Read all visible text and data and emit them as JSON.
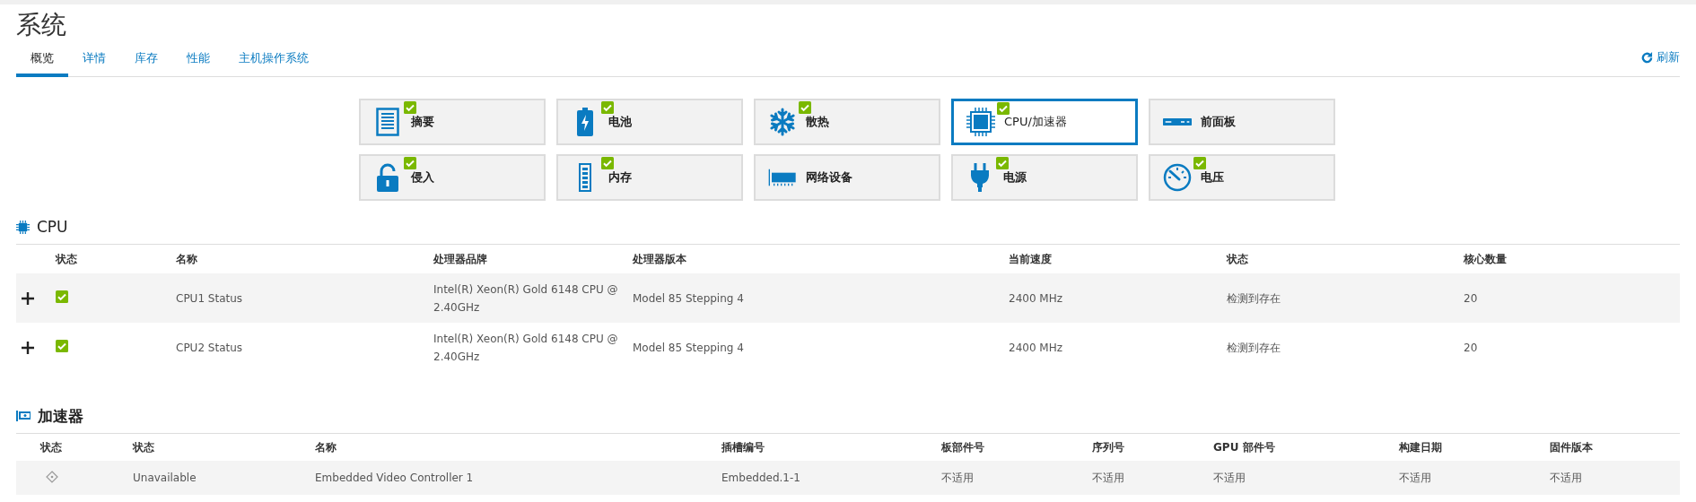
{
  "title": "系统",
  "tabs": [
    {
      "label": "概览",
      "selected": true
    },
    {
      "label": "详情",
      "selected": false
    },
    {
      "label": "库存",
      "selected": false
    },
    {
      "label": "性能",
      "selected": false
    },
    {
      "label": "主机操作系统",
      "selected": false
    }
  ],
  "refresh": "刷新",
  "tiles": [
    {
      "label": "摘要",
      "ok": true,
      "selected": false
    },
    {
      "label": "电池",
      "ok": true,
      "selected": false
    },
    {
      "label": "散热",
      "ok": true,
      "selected": false
    },
    {
      "label": "CPU/加速器",
      "ok": true,
      "selected": true
    },
    {
      "label": "前面板",
      "ok": false,
      "selected": false
    },
    {
      "label": "侵入",
      "ok": true,
      "selected": false
    },
    {
      "label": "内存",
      "ok": true,
      "selected": false
    },
    {
      "label": "网络设备",
      "ok": false,
      "selected": false
    },
    {
      "label": "电源",
      "ok": true,
      "selected": false
    },
    {
      "label": "电压",
      "ok": true,
      "selected": false
    }
  ],
  "cpu": {
    "title": "CPU",
    "status_column": "状态",
    "columns": [
      "名称",
      "处理器品牌",
      "处理器版本",
      "当前速度",
      "状态",
      "核心数量"
    ],
    "rows": [
      {
        "expanded": false,
        "ok": true,
        "cells": [
          "CPU1 Status",
          "Intel(R) Xeon(R) Gold 6148 CPU @ 2.40GHz",
          "Model 85 Stepping 4",
          "2400 MHz",
          "检测到存在",
          "20"
        ]
      },
      {
        "expanded": false,
        "ok": true,
        "cells": [
          "CPU2 Status",
          "Intel(R) Xeon(R) Gold 6148 CPU @ 2.40GHz",
          "Model 85 Stepping 4",
          "2400 MHz",
          "检测到存在",
          "20"
        ]
      }
    ]
  },
  "accelerators": {
    "title": "加速器",
    "status_column": "状态",
    "columns": [
      "状态",
      "名称",
      "插槽编号",
      "板部件号",
      "序列号",
      "GPU 部件号",
      "构建日期",
      "固件版本"
    ],
    "rows": [
      {
        "ok": false,
        "cells": [
          "Unavailable",
          "Embedded Video Controller 1",
          "Embedded.1-1",
          "不适用",
          "不适用",
          "不适用",
          "不适用",
          "不适用"
        ]
      }
    ]
  }
}
